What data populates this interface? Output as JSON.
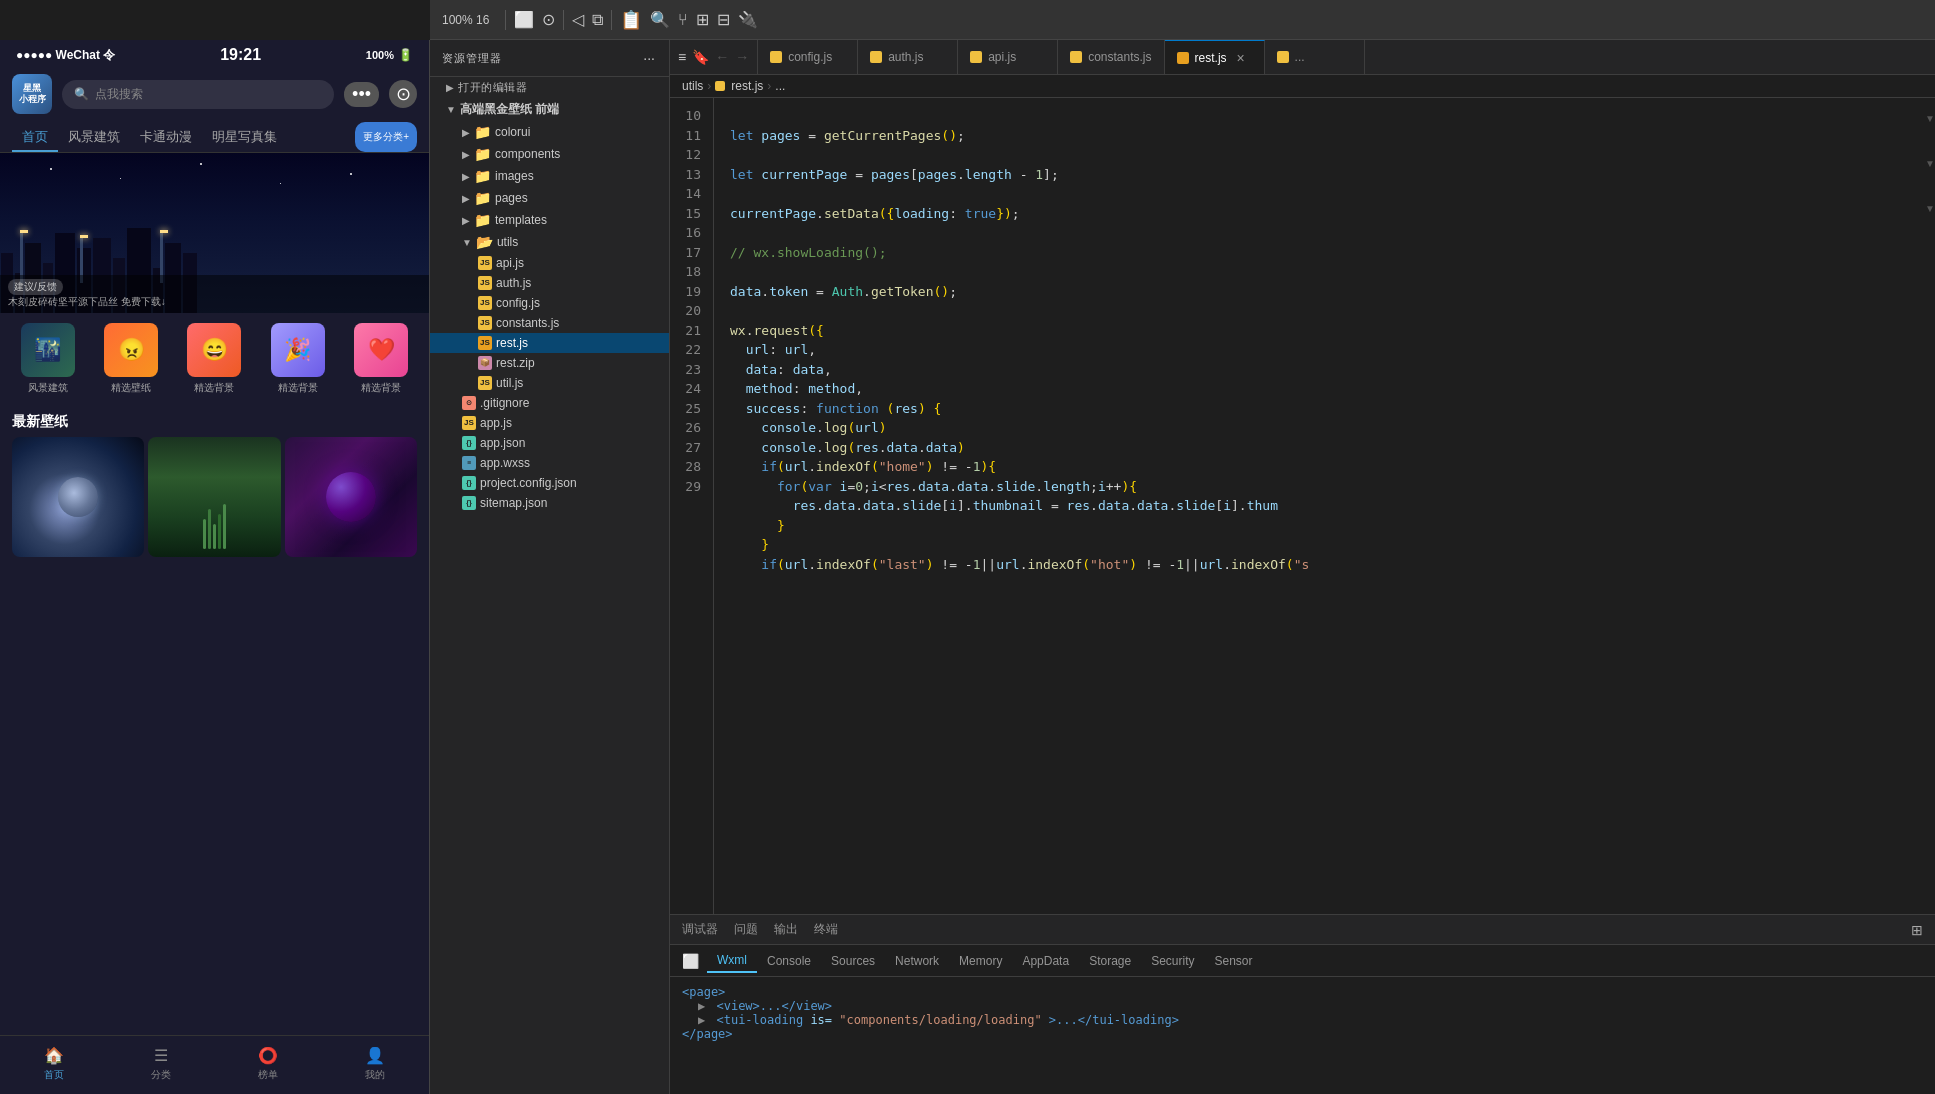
{
  "toolbar": {
    "zoom_label": "100% 16",
    "icons": [
      "device-icon",
      "record-icon",
      "back-icon",
      "copy-icon",
      "clipboard-icon",
      "search-icon",
      "git-icon",
      "grid-icon",
      "layout-icon",
      "more-icon"
    ]
  },
  "explorer": {
    "title": "资源管理器",
    "more_label": "···",
    "sections": [
      {
        "label": "打开的编辑器",
        "expanded": false
      },
      {
        "label": "高端黑金壁纸 前端",
        "expanded": true,
        "children": [
          {
            "type": "folder",
            "label": "colorui",
            "expanded": false,
            "indent": 1
          },
          {
            "type": "folder",
            "label": "components",
            "expanded": false,
            "indent": 1
          },
          {
            "type": "folder",
            "label": "images",
            "expanded": false,
            "indent": 1
          },
          {
            "type": "folder",
            "label": "pages",
            "expanded": false,
            "indent": 1
          },
          {
            "type": "folder",
            "label": "templates",
            "expanded": false,
            "indent": 1
          },
          {
            "type": "folder",
            "label": "utils",
            "expanded": true,
            "indent": 1
          },
          {
            "type": "file",
            "ext": "js",
            "label": "api.js",
            "indent": 2
          },
          {
            "type": "file",
            "ext": "js",
            "label": "auth.js",
            "indent": 2
          },
          {
            "type": "file",
            "ext": "js",
            "label": "config.js",
            "indent": 2
          },
          {
            "type": "file",
            "ext": "js",
            "label": "constants.js",
            "indent": 2
          },
          {
            "type": "file",
            "ext": "js",
            "label": "rest.js",
            "indent": 2,
            "selected": true
          },
          {
            "type": "file",
            "ext": "zip",
            "label": "rest.zip",
            "indent": 2
          },
          {
            "type": "file",
            "ext": "js",
            "label": "util.js",
            "indent": 2
          }
        ]
      }
    ],
    "root_files": [
      {
        "type": "file",
        "ext": "gitignore",
        "label": ".gitignore"
      },
      {
        "type": "file",
        "ext": "js",
        "label": "app.js"
      },
      {
        "type": "file",
        "ext": "json",
        "label": "app.json"
      },
      {
        "type": "file",
        "ext": "wxss",
        "label": "app.wxss"
      },
      {
        "type": "file",
        "ext": "json",
        "label": "project.config.json"
      },
      {
        "type": "file",
        "ext": "json",
        "label": "sitemap.json"
      }
    ]
  },
  "editor": {
    "tabs": [
      {
        "label": "config.js",
        "ext": "js",
        "active": false
      },
      {
        "label": "auth.js",
        "ext": "js",
        "active": false
      },
      {
        "label": "api.js",
        "ext": "js",
        "active": false
      },
      {
        "label": "constants.js",
        "ext": "js",
        "active": false
      },
      {
        "label": "rest.js",
        "ext": "js",
        "active": true,
        "closeable": true
      }
    ],
    "breadcrumb": [
      "utils",
      "rest.js",
      "..."
    ],
    "breadcrumb_nav": [
      "←",
      "→"
    ],
    "lines": {
      "start": 10,
      "end": 29
    }
  },
  "bottom_panel": {
    "tabs": [
      {
        "label": "调试器",
        "active": false
      },
      {
        "label": "问题",
        "active": false
      },
      {
        "label": "输出",
        "active": false
      },
      {
        "label": "终端",
        "active": false
      }
    ],
    "devtools_tabs": [
      {
        "label": "Wxml",
        "active": true
      },
      {
        "label": "Console",
        "active": false
      },
      {
        "label": "Sources",
        "active": false
      },
      {
        "label": "Network",
        "active": false
      },
      {
        "label": "Memory",
        "active": false
      },
      {
        "label": "AppData",
        "active": false
      },
      {
        "label": "Storage",
        "active": false
      },
      {
        "label": "Security",
        "active": false
      },
      {
        "label": "Sensor",
        "active": false
      }
    ],
    "wxml": {
      "lines": [
        {
          "indent": 0,
          "text": "<page>",
          "tag": true
        },
        {
          "indent": 1,
          "collapsible": true,
          "text": "<view>...</view>"
        },
        {
          "indent": 1,
          "collapsible": true,
          "text": "<tui-loading is=\"components/loading/loading\">...</tui-loading>"
        },
        {
          "indent": 0,
          "text": "</page>",
          "tag": true
        }
      ]
    }
  },
  "phone": {
    "status_time": "19:21",
    "battery": "100%",
    "app_title_line1": "星黑",
    "app_title_line2": "小程序",
    "search_placeholder": "点我搜索",
    "tabs": [
      {
        "label": "首页",
        "active": true
      },
      {
        "label": "风景建筑",
        "active": false
      },
      {
        "label": "卡通动漫",
        "active": false
      },
      {
        "label": "明星写真集",
        "active": false
      },
      {
        "label": "更多分类+",
        "more": true
      }
    ],
    "banner_caption1": "建议/反馈",
    "banner_caption2": "木刻皮碎砖坚平源下品丝 免费下载↓",
    "icons": [
      {
        "label": "风景建筑",
        "emoji": "🌃"
      },
      {
        "label": "精选壁纸",
        "emoji": "😠"
      },
      {
        "label": "精选背景",
        "emoji": "😄"
      },
      {
        "label": "精选背景",
        "emoji": "🎉"
      },
      {
        "label": "精选背景",
        "emoji": "❤️"
      }
    ],
    "section_title": "最新壁纸",
    "nav_items": [
      {
        "label": "首页",
        "active": true,
        "icon": "🏠"
      },
      {
        "label": "分类",
        "active": false,
        "icon": "☰"
      },
      {
        "label": "榜单",
        "active": false,
        "icon": "⭕"
      },
      {
        "label": "我的",
        "active": false,
        "icon": "👤"
      }
    ]
  }
}
